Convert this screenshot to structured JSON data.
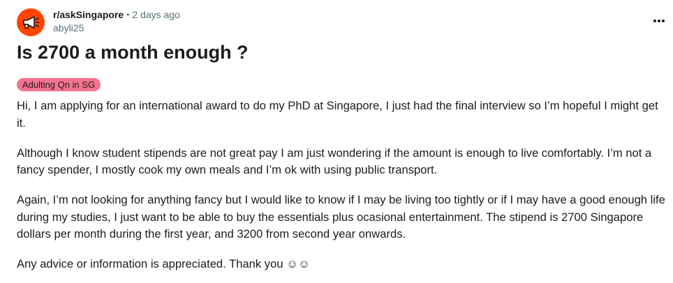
{
  "post": {
    "subreddit": "r/askSingapore",
    "separator": "•",
    "time": "2 days ago",
    "author": "abyli25",
    "avatar_icon": "megaphone-icon",
    "more_icon": "more-options-icon",
    "title": "Is 2700 a month enough ?",
    "flair": {
      "label": "Adulting Qn in SG",
      "color": "#f4738e"
    },
    "paragraphs": [
      "Hi, I am applying for an international award to do my PhD at Singapore, I just had the final interview so I’m hopeful I might get it.",
      "Although I know student stipends are not great pay I am just wondering if the amount is enough to live comfortably. I’m not a fancy spender, I mostly cook my own meals and I’m ok with using public transport.",
      "Again, I’m not looking for anything fancy but I would like to know if I may be living too tightly or if I may have a good enough life during my studies, I just want to be able to buy the essentials plus ocasional entertainment. The stipend is 2700 Singapore dollars per month during the first year, and 3200 from second year onwards.",
      "Any advice or information is appreciated. Thank you ☺☺"
    ]
  },
  "colors": {
    "avatar_bg": "#ff4500",
    "meta_text": "#576f76",
    "text": "#1c1c1c"
  }
}
